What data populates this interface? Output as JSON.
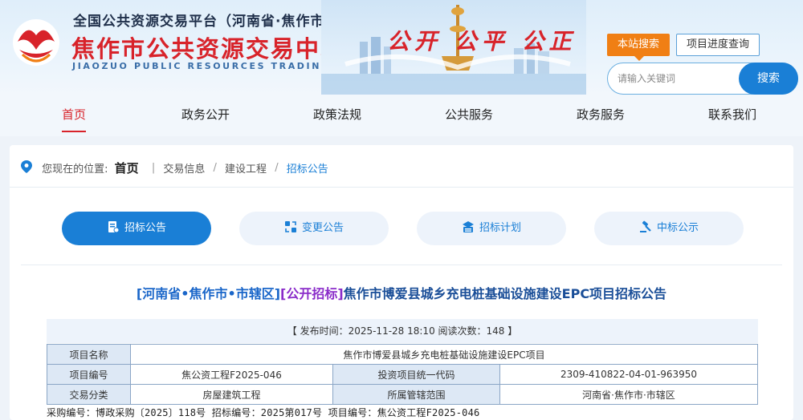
{
  "header": {
    "platform_name": "全国公共资源交易平台（河南省·焦作市）",
    "center_name": "焦作市公共资源交易中心",
    "center_name_en": "JIAOZUO PUBLIC RESOURCES TRADING CENTER",
    "slogan": "公开 公平 公正",
    "site_search_label": "本站搜索",
    "progress_label": "项目进度查询",
    "search_placeholder": "请输入关键词",
    "search_button": "搜索"
  },
  "nav": {
    "items": [
      {
        "label": "首页",
        "active": true
      },
      {
        "label": "政务公开",
        "active": false
      },
      {
        "label": "政策法规",
        "active": false
      },
      {
        "label": "公共服务",
        "active": false
      },
      {
        "label": "政务服务",
        "active": false
      },
      {
        "label": "联系我们",
        "active": false
      }
    ]
  },
  "breadcrumb": {
    "prefix": "您现在的位置:",
    "home": "首页",
    "items": [
      "交易信息",
      "建设工程",
      "招标公告"
    ]
  },
  "tabs": [
    {
      "label": "招标公告",
      "icon": "document-icon",
      "active": true
    },
    {
      "label": "变更公告",
      "icon": "exchange-icon",
      "active": false
    },
    {
      "label": "招标计划",
      "icon": "stack-icon",
      "active": false
    },
    {
      "label": "中标公示",
      "icon": "gavel-icon",
      "active": false
    }
  ],
  "article": {
    "title_region": "[河南省•焦作市•市辖区]",
    "title_type": "[公开招标]",
    "title_main": "焦作市博爱县城乡充电桩基础设施建设EPC项目招标公告",
    "meta": "【 发布时间：2025-11-28 18:10   阅读次数：148 】",
    "table": {
      "project_name_label": "项目名称",
      "project_name": "焦作市博爱县城乡充电桩基础设施建设EPC项目",
      "project_no_label": "项目编号",
      "project_no": "焦公资工程F2025-046",
      "invest_code_label": "投资项目统一代码",
      "invest_code": "2309-410822-04-01-963950",
      "category_label": "交易分类",
      "category": "房屋建筑工程",
      "jurisdiction_label": "所属管辖范围",
      "jurisdiction": "河南省·焦作市·市辖区"
    },
    "codes_line": "采购编号：博政采购〔2025〕118号 招标编号：2025第017号 项目编号：焦公资工程F2025-046"
  },
  "colors": {
    "brand_red": "#d8232a",
    "primary_blue": "#1a7fd6",
    "accent_orange": "#f07f14"
  }
}
